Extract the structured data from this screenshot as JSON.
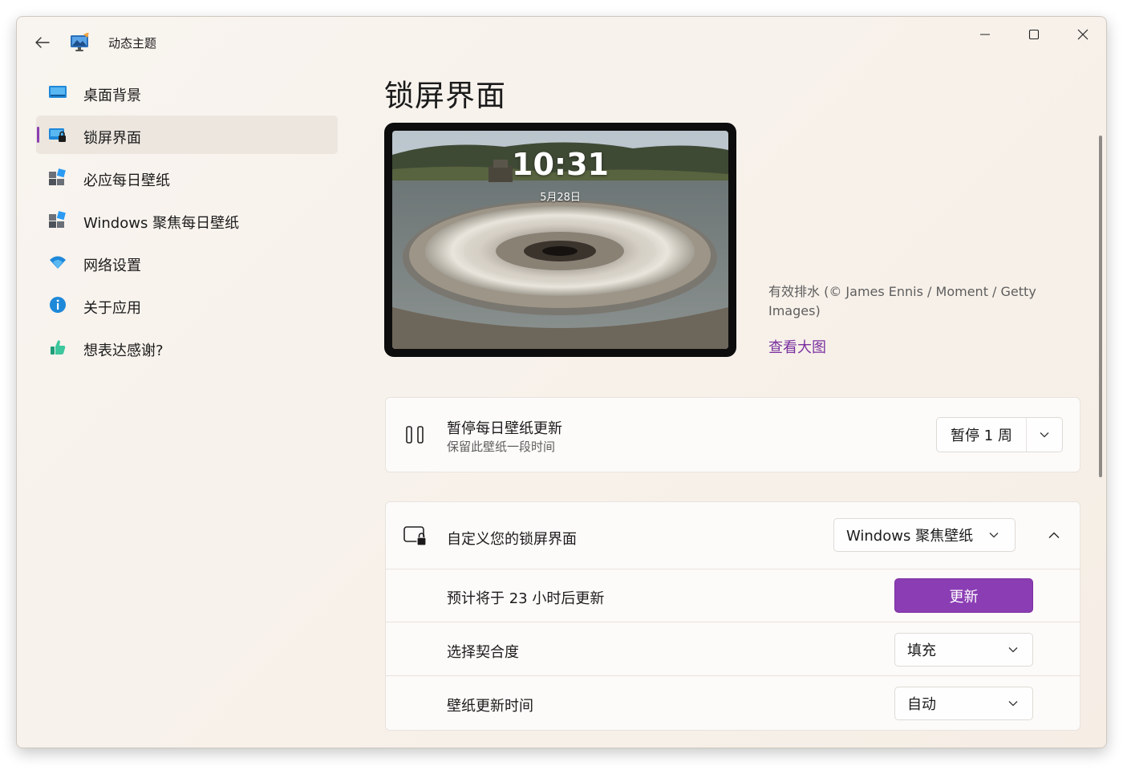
{
  "titlebar": {
    "app_title": "动态主题"
  },
  "nav": {
    "items": [
      {
        "label": "桌面背景",
        "icon": "desktop-background-icon"
      },
      {
        "label": "锁屏界面",
        "icon": "lock-screen-icon",
        "active": true
      },
      {
        "label": "必应每日壁纸",
        "icon": "bing-wallpaper-icon"
      },
      {
        "label": "Windows 聚焦每日壁纸",
        "icon": "spotlight-wallpaper-icon"
      },
      {
        "label": "网络设置",
        "icon": "wifi-icon"
      },
      {
        "label": "关于应用",
        "icon": "info-icon"
      },
      {
        "label": "想表达感谢?",
        "icon": "thumbs-up-icon"
      }
    ]
  },
  "main": {
    "page_title": "锁屏界面",
    "preview": {
      "time": "10:31",
      "date": "5月28日"
    },
    "credit": "有效排水 (© James Ennis / Moment / Getty Images)",
    "view_large": "查看大图"
  },
  "pause_card": {
    "title": "暂停每日壁纸更新",
    "subtitle": "保留此壁纸一段时间",
    "button_label": "暂停 1 周"
  },
  "custom_card": {
    "title": "自定义您的锁屏界面",
    "source_dropdown": "Windows 聚焦壁纸",
    "rows": [
      {
        "label": "预计将于 23 小时后更新",
        "button": "更新"
      },
      {
        "label": "选择契合度",
        "value": "填充"
      },
      {
        "label": "壁纸更新时间",
        "value": "自动"
      }
    ]
  },
  "colors": {
    "accent": "#8b3db4",
    "link": "#7a2f9f",
    "window_bg": "#f8f4ef"
  }
}
